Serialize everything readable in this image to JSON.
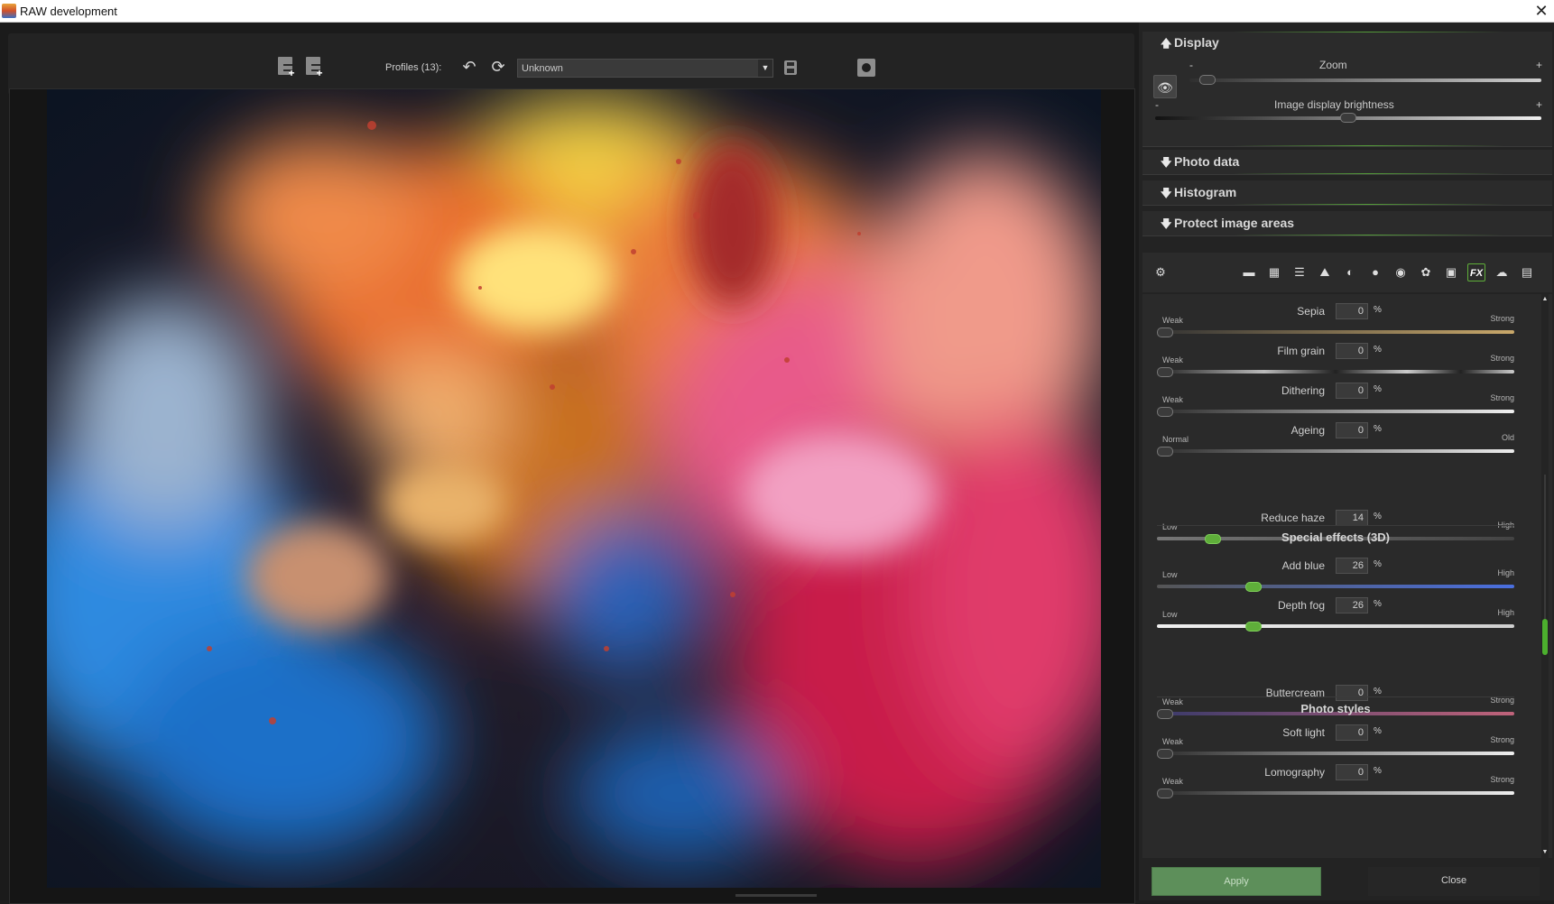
{
  "window": {
    "title": "RAW development",
    "close_glyph": "✕"
  },
  "toolbar": {
    "profiles_label": "Profiles (13):",
    "profile_value": "Unknown"
  },
  "panel": {
    "display": {
      "title": "Display",
      "zoom_label": "Zoom",
      "zoom_min": "-",
      "zoom_max": "+",
      "zoom_level": 0.03,
      "brightness_label": "Image display brightness",
      "brightness_min": "-",
      "brightness_max": "+",
      "brightness_level": 0.5
    },
    "photo_data_title": "Photo data",
    "histogram_title": "Histogram",
    "protect_title": "Protect image areas",
    "tabs": [
      {
        "name": "settings-gear-icon"
      },
      {
        "name": "gradient-icon"
      },
      {
        "name": "curves-icon"
      },
      {
        "name": "lines-icon"
      },
      {
        "name": "landscape-icon"
      },
      {
        "name": "contrast-icon"
      },
      {
        "name": "sphere-icon"
      },
      {
        "name": "color-wheel-icon"
      },
      {
        "name": "palette-icon"
      },
      {
        "name": "camera-icon"
      },
      {
        "name": "fx-icon",
        "label": "FX"
      },
      {
        "name": "brain-icon"
      },
      {
        "name": "stack-icon"
      }
    ],
    "effects": [
      {
        "name": "Sepia",
        "value": "0",
        "unit": "%",
        "lo": "Weak",
        "hi": "Strong",
        "level": 0,
        "track": "sepia"
      },
      {
        "name": "Film grain",
        "value": "0",
        "unit": "%",
        "lo": "Weak",
        "hi": "Strong",
        "level": 0,
        "track": "grain"
      },
      {
        "name": "Dithering",
        "value": "0",
        "unit": "%",
        "lo": "Weak",
        "hi": "Strong",
        "level": 0,
        "track": "white"
      },
      {
        "name": "Ageing",
        "value": "0",
        "unit": "%",
        "lo": "Normal",
        "hi": "Old",
        "level": 0,
        "track": "age"
      }
    ],
    "special_title": "Special effects (3D)",
    "special": [
      {
        "name": "Reduce haze",
        "value": "14",
        "unit": "%",
        "lo": "Low",
        "hi": "High",
        "level": 0.14,
        "track": "haze"
      },
      {
        "name": "Add blue",
        "value": "26",
        "unit": "%",
        "lo": "Low",
        "hi": "High",
        "level": 0.26,
        "track": "blue"
      },
      {
        "name": "Depth fog",
        "value": "26",
        "unit": "%",
        "lo": "Low",
        "hi": "High",
        "level": 0.26,
        "track": "fog"
      }
    ],
    "styles_title": "Photo styles",
    "styles": [
      {
        "name": "Buttercream",
        "value": "0",
        "unit": "%",
        "lo": "Weak",
        "hi": "Strong",
        "level": 0,
        "track": "butter"
      },
      {
        "name": "Soft light",
        "value": "0",
        "unit": "%",
        "lo": "Weak",
        "hi": "Strong",
        "level": 0,
        "track": "white"
      },
      {
        "name": "Lomography",
        "value": "0",
        "unit": "%",
        "lo": "Weak",
        "hi": "Strong",
        "level": 0,
        "track": "white"
      }
    ],
    "apply_label": "Apply",
    "close_label": "Close"
  },
  "colors": {
    "accent": "#5fae3a",
    "panel": "#2b2b2b"
  }
}
